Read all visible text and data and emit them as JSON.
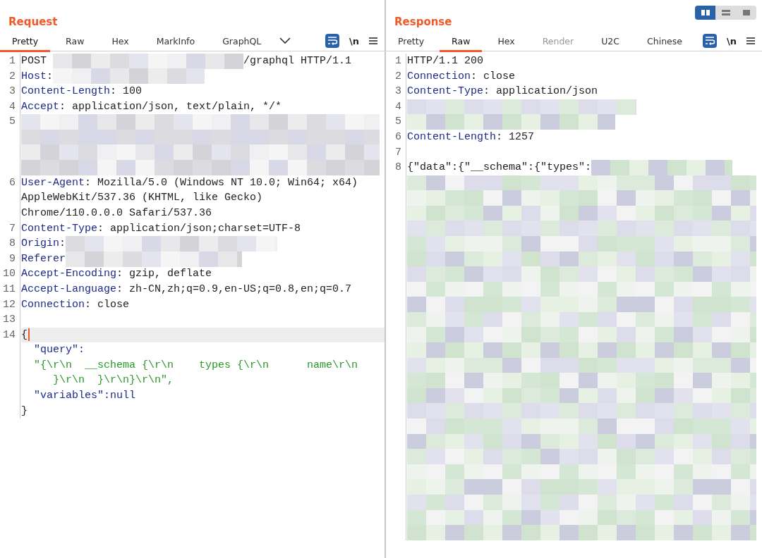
{
  "layout_toggle": [
    {
      "kind": "columns",
      "selected": true
    },
    {
      "kind": "rows",
      "selected": false
    },
    {
      "kind": "single",
      "selected": false
    }
  ],
  "panes": [
    {
      "title": "Request",
      "tabs": [
        {
          "label": "Pretty",
          "selected": true,
          "disabled": false
        },
        {
          "label": "Raw",
          "selected": false,
          "disabled": false
        },
        {
          "label": "Hex",
          "selected": false,
          "disabled": false
        },
        {
          "label": "MarkInfo",
          "selected": false,
          "disabled": false
        },
        {
          "label": "GraphQL",
          "selected": false,
          "disabled": false
        }
      ],
      "more_tabs": true,
      "wrap_on": true,
      "newline_toggle": "\\n",
      "lines": [
        {
          "number": "1",
          "current": false,
          "rows": [
            [
              {
                "kind": "text",
                "text": "POST "
              },
              {
                "kind": "redacted"
              },
              {
                "kind": "text",
                "text": "/graphql HTTP/1.1"
              }
            ]
          ]
        },
        {
          "number": "2",
          "current": false,
          "rows": [
            [
              {
                "kind": "key",
                "text": "Host"
              },
              {
                "kind": "text",
                "text": ":"
              },
              {
                "kind": "redacted"
              }
            ]
          ]
        },
        {
          "number": "3",
          "current": false,
          "rows": [
            [
              {
                "kind": "key",
                "text": "Content-Length"
              },
              {
                "kind": "text",
                "text": ": 100"
              }
            ]
          ]
        },
        {
          "number": "4",
          "current": false,
          "rows": [
            [
              {
                "kind": "key",
                "text": "Accept"
              },
              {
                "kind": "text",
                "text": ": application/json, text/plain, */*"
              }
            ]
          ]
        },
        {
          "number": "5",
          "current": false,
          "rows": [
            [
              {
                "kind": "redacted"
              }
            ],
            [
              {
                "kind": "redacted"
              }
            ],
            [
              {
                "kind": "redacted"
              }
            ],
            [
              {
                "kind": "redacted"
              }
            ]
          ]
        },
        {
          "number": "6",
          "current": false,
          "rows": [
            [
              {
                "kind": "key",
                "text": "User-Agent"
              },
              {
                "kind": "text",
                "text": ": Mozilla/5.0 (Windows NT 10.0; Win64; x64)"
              }
            ],
            [
              {
                "kind": "text",
                "text": "AppleWebKit/537.36 (KHTML, like Gecko)"
              }
            ],
            [
              {
                "kind": "text",
                "text": "Chrome/110.0.0.0 Safari/537.36"
              }
            ]
          ]
        },
        {
          "number": "7",
          "current": false,
          "rows": [
            [
              {
                "kind": "key",
                "text": "Content-Type"
              },
              {
                "kind": "text",
                "text": ": application/json;charset=UTF-8"
              }
            ]
          ]
        },
        {
          "number": "8",
          "current": false,
          "rows": [
            [
              {
                "kind": "key",
                "text": "Origin"
              },
              {
                "kind": "text",
                "text": ":"
              },
              {
                "kind": "redacted"
              }
            ]
          ]
        },
        {
          "number": "9",
          "current": false,
          "rows": [
            [
              {
                "kind": "key",
                "text": "Referer"
              },
              {
                "kind": "redacted"
              }
            ]
          ]
        },
        {
          "number": "10",
          "current": false,
          "rows": [
            [
              {
                "kind": "key",
                "text": "Accept-Encoding"
              },
              {
                "kind": "text",
                "text": ": gzip, deflate"
              }
            ]
          ]
        },
        {
          "number": "11",
          "current": false,
          "rows": [
            [
              {
                "kind": "key",
                "text": "Accept-Language"
              },
              {
                "kind": "text",
                "text": ": zh-CN,zh;q=0.9,en-US;q=0.8,en;q=0.7"
              }
            ]
          ]
        },
        {
          "number": "12",
          "current": false,
          "rows": [
            [
              {
                "kind": "key",
                "text": "Connection"
              },
              {
                "kind": "text",
                "text": ": close"
              }
            ]
          ]
        },
        {
          "number": "13",
          "current": false,
          "rows": [
            []
          ]
        },
        {
          "number": "14",
          "current": true,
          "rows": [
            [
              {
                "kind": "text",
                "text": "{"
              }
            ],
            [
              {
                "kind": "key",
                "text": "  \"query\":"
              }
            ],
            [
              {
                "kind": "string",
                "text": "  \"{\\r\\n  __schema {\\r\\n    types {\\r\\n      name\\r\\n"
              }
            ],
            [
              {
                "kind": "string",
                "text": "     }\\r\\n  }\\r\\n}\\r\\n\","
              }
            ],
            [
              {
                "kind": "key",
                "text": "  \"variables\":null"
              }
            ],
            [
              {
                "kind": "text",
                "text": "}"
              }
            ]
          ]
        }
      ]
    },
    {
      "title": "Response",
      "tabs": [
        {
          "label": "Pretty",
          "selected": false,
          "disabled": false
        },
        {
          "label": "Raw",
          "selected": true,
          "disabled": false
        },
        {
          "label": "Hex",
          "selected": false,
          "disabled": false
        },
        {
          "label": "Render",
          "selected": false,
          "disabled": true
        },
        {
          "label": "U2C",
          "selected": false,
          "disabled": false
        },
        {
          "label": "Chinese",
          "selected": false,
          "disabled": false
        }
      ],
      "wrap_on": true,
      "newline_toggle": "\\n",
      "lines": [
        {
          "number": "1",
          "current": false,
          "rows": [
            [
              {
                "kind": "text",
                "text": "HTTP/1.1 200"
              }
            ]
          ]
        },
        {
          "number": "2",
          "current": false,
          "rows": [
            [
              {
                "kind": "key",
                "text": "Connection"
              },
              {
                "kind": "text",
                "text": ": close"
              }
            ]
          ]
        },
        {
          "number": "3",
          "current": false,
          "rows": [
            [
              {
                "kind": "key",
                "text": "Content-Type"
              },
              {
                "kind": "text",
                "text": ": application/json"
              }
            ]
          ]
        },
        {
          "number": "4",
          "current": false,
          "rows": [
            [
              {
                "kind": "redacted"
              }
            ]
          ]
        },
        {
          "number": "5",
          "current": false,
          "rows": [
            [
              {
                "kind": "redacted"
              }
            ]
          ]
        },
        {
          "number": "6",
          "current": false,
          "rows": [
            [
              {
                "kind": "key",
                "text": "Content-Length"
              },
              {
                "kind": "text",
                "text": ": 1257"
              }
            ]
          ]
        },
        {
          "number": "7",
          "current": false,
          "rows": [
            []
          ]
        },
        {
          "number": "8",
          "current": false,
          "rows": [
            [
              {
                "kind": "text",
                "text": "{\"data\":{\"__schema\":{\"types\":"
              },
              {
                "kind": "redacted"
              }
            ],
            [
              {
                "kind": "redacted"
              }
            ],
            [
              {
                "kind": "redacted"
              }
            ],
            [
              {
                "kind": "redacted"
              }
            ],
            [
              {
                "kind": "redacted"
              }
            ],
            [
              {
                "kind": "redacted"
              }
            ],
            [
              {
                "kind": "redacted"
              }
            ],
            [
              {
                "kind": "redacted"
              }
            ],
            [
              {
                "kind": "redacted"
              }
            ],
            [
              {
                "kind": "redacted"
              }
            ],
            [
              {
                "kind": "redacted"
              }
            ],
            [
              {
                "kind": "redacted"
              }
            ],
            [
              {
                "kind": "redacted"
              }
            ],
            [
              {
                "kind": "redacted"
              }
            ],
            [
              {
                "kind": "redacted"
              }
            ],
            [
              {
                "kind": "redacted"
              }
            ],
            [
              {
                "kind": "redacted"
              }
            ],
            [
              {
                "kind": "redacted"
              }
            ],
            [
              {
                "kind": "redacted"
              }
            ],
            [
              {
                "kind": "redacted"
              }
            ],
            [
              {
                "kind": "redacted"
              }
            ],
            [
              {
                "kind": "redacted"
              }
            ],
            [
              {
                "kind": "redacted"
              }
            ],
            [
              {
                "kind": "redacted"
              }
            ],
            [
              {
                "kind": "redacted"
              }
            ]
          ]
        }
      ]
    }
  ]
}
